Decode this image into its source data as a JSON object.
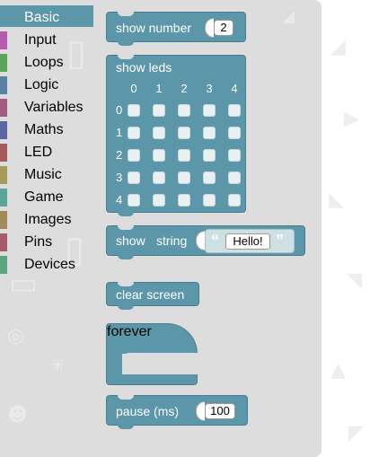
{
  "sidebar": {
    "items": [
      {
        "label": "Basic",
        "color": "#5b97a8",
        "selected": true
      },
      {
        "label": "Input",
        "color": "#b75ab0",
        "selected": false
      },
      {
        "label": "Loops",
        "color": "#5aa55a",
        "selected": false
      },
      {
        "label": "Logic",
        "color": "#5b80a5",
        "selected": false
      },
      {
        "label": "Variables",
        "color": "#a55b80",
        "selected": false
      },
      {
        "label": "Maths",
        "color": "#5b67a5",
        "selected": false
      },
      {
        "label": "LED",
        "color": "#a55b5b",
        "selected": false
      },
      {
        "label": "Music",
        "color": "#a59b5b",
        "selected": false
      },
      {
        "label": "Game",
        "color": "#5ba59b",
        "selected": false
      },
      {
        "label": "Images",
        "color": "#a5885b",
        "selected": false
      },
      {
        "label": "Pins",
        "color": "#a55b6b",
        "selected": false
      },
      {
        "label": "Devices",
        "color": "#5ba580",
        "selected": false
      }
    ]
  },
  "blocks": {
    "show_number": {
      "label": "show number",
      "value": "2"
    },
    "show_leds": {
      "label": "show leds",
      "columns": [
        "0",
        "1",
        "2",
        "3",
        "4"
      ],
      "rows": [
        "0",
        "1",
        "2",
        "3",
        "4"
      ],
      "lit": [
        [
          false,
          false,
          false,
          false,
          false
        ],
        [
          false,
          false,
          false,
          false,
          false
        ],
        [
          false,
          false,
          false,
          false,
          false
        ],
        [
          false,
          false,
          false,
          false,
          false
        ],
        [
          false,
          false,
          false,
          false,
          false
        ]
      ]
    },
    "show_string": {
      "label_show": "show",
      "label_string": "string",
      "open_quote": "“",
      "value": "Hello!",
      "close_quote": "”"
    },
    "clear_screen": {
      "label": "clear screen"
    },
    "forever": {
      "label": "forever"
    },
    "pause": {
      "label": "pause (ms)",
      "value": "100"
    }
  },
  "colors": {
    "block": "#5b97a8",
    "flyout": "#dddddd"
  }
}
